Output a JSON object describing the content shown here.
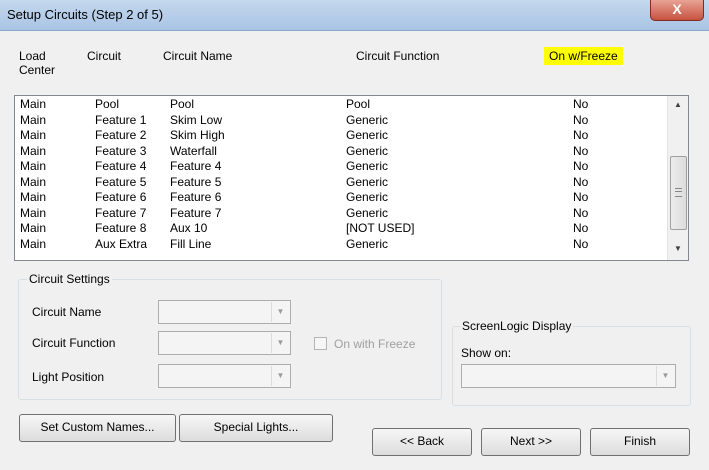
{
  "window": {
    "title": "Setup Circuits (Step 2 of 5)",
    "close_glyph": "X"
  },
  "columns": {
    "load_center": "Load\nCenter",
    "circuit": "Circuit",
    "circuit_name": "Circuit Name",
    "circuit_function": "Circuit Function",
    "on_freeze": "On w/Freeze"
  },
  "rows": [
    [
      "Main",
      "Pool",
      "Pool",
      "Pool",
      "No"
    ],
    [
      "Main",
      "Feature 1",
      "Skim Low",
      "Generic",
      "No"
    ],
    [
      "Main",
      "Feature 2",
      "Skim High",
      "Generic",
      "No"
    ],
    [
      "Main",
      "Feature 3",
      "Waterfall",
      "Generic",
      "No"
    ],
    [
      "Main",
      "Feature 4",
      "Feature 4",
      "Generic",
      "No"
    ],
    [
      "Main",
      "Feature 5",
      "Feature 5",
      "Generic",
      "No"
    ],
    [
      "Main",
      "Feature 6",
      "Feature 6",
      "Generic",
      "No"
    ],
    [
      "Main",
      "Feature 7",
      "Feature 7",
      "Generic",
      "No"
    ],
    [
      "Main",
      "Feature 8",
      "Aux 10",
      "[NOT USED]",
      "No"
    ],
    [
      "Main",
      "Aux Extra",
      "Fill Line",
      "Generic",
      "No"
    ]
  ],
  "scrollbar": {
    "up_icon": "▲",
    "down_icon": "▼"
  },
  "circuit_settings": {
    "legend": "Circuit Settings",
    "circuit_name_label": "Circuit Name",
    "circuit_function_label": "Circuit Function",
    "light_position_label": "Light Position",
    "on_with_freeze_label": "On with Freeze",
    "dropdown_icon": "▼"
  },
  "screenlogic": {
    "legend": "ScreenLogic Display",
    "show_on_label": "Show on:",
    "dropdown_icon": "▼"
  },
  "buttons": {
    "set_custom_names": "Set Custom Names...",
    "special_lights": "Special Lights...",
    "back": "<< Back",
    "next": "Next >>",
    "finish": "Finish"
  }
}
